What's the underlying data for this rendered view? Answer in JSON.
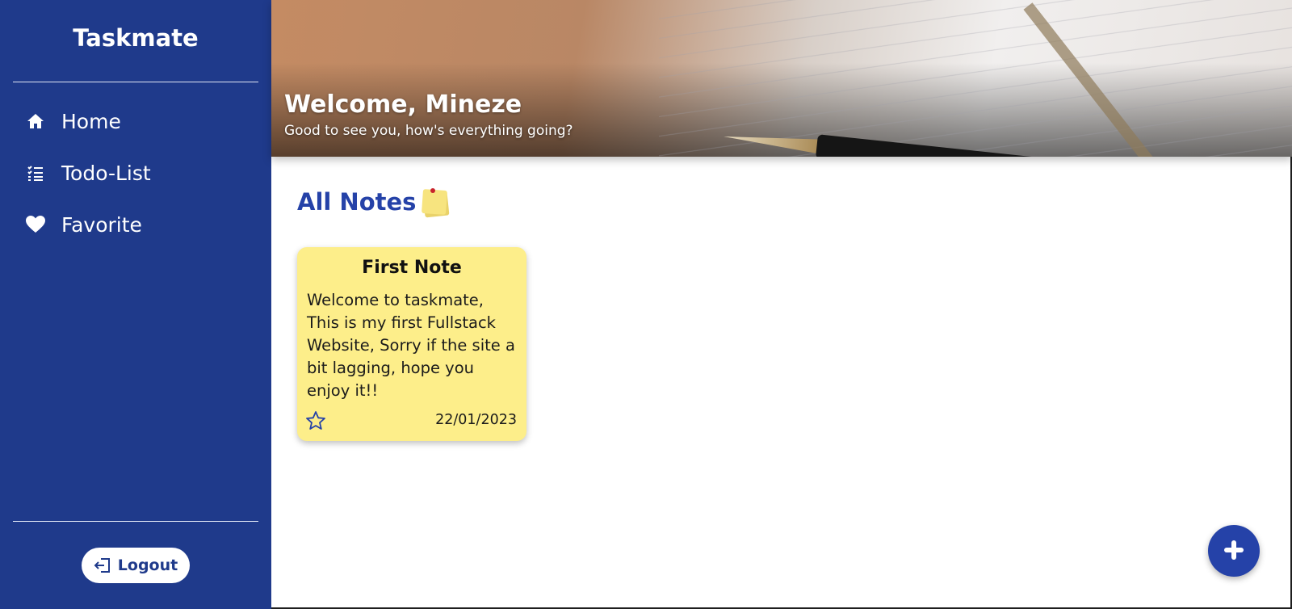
{
  "app": {
    "brand": "Taskmate"
  },
  "sidebar": {
    "items": [
      {
        "label": "Home",
        "icon": "home-icon"
      },
      {
        "label": "Todo-List",
        "icon": "list-icon"
      },
      {
        "label": "Favorite",
        "icon": "heart-icon"
      }
    ],
    "logout_label": "Logout",
    "logout_icon": "logout-icon"
  },
  "header": {
    "welcome": "Welcome, Mineze",
    "subtitle": "Good to see you, how's everything going?"
  },
  "main": {
    "section_title": "All Notes",
    "section_icon": "sticky-note-icon",
    "notes": [
      {
        "title": "First Note",
        "body": "Welcome to taskmate, This is my first Fullstack Website, Sorry if the site a bit lagging, hope you enjoy it!!",
        "date": "22/01/2023",
        "favorite": false
      }
    ]
  },
  "fab": {
    "icon": "plus-icon"
  },
  "colors": {
    "sidebar": "#1f3a8b",
    "accent": "#2542a8",
    "note": "#fdee8a"
  }
}
